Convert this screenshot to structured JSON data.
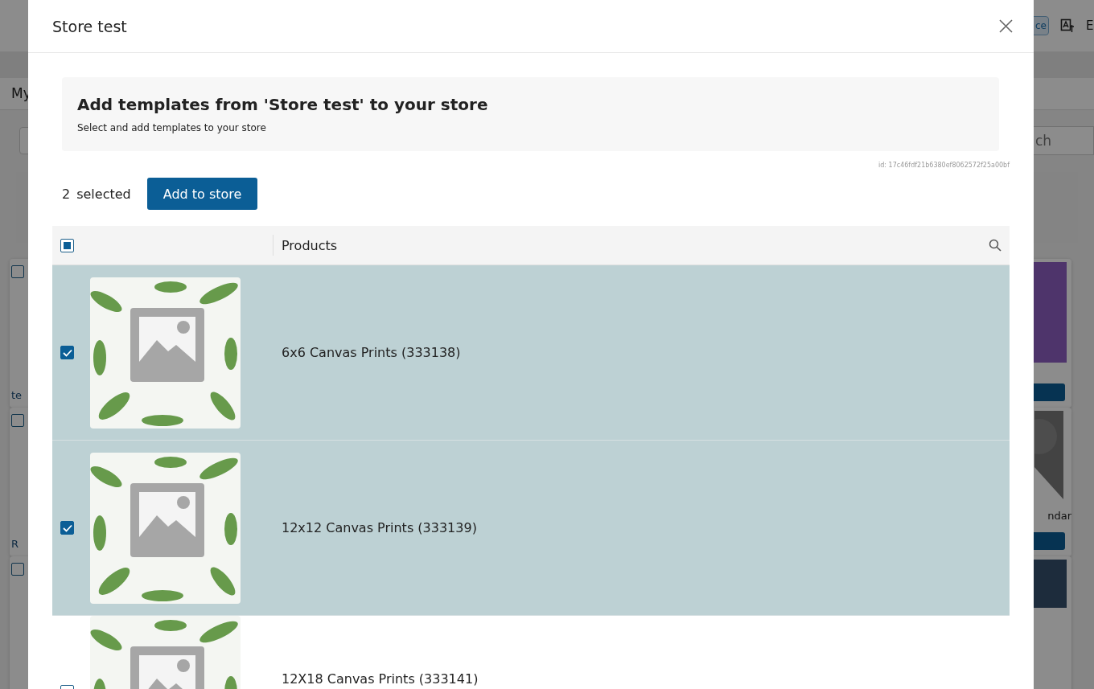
{
  "background": {
    "header_button": "ce",
    "header_link": "E",
    "tab": "My",
    "search": {
      "placeholder": "ch"
    },
    "card_rows": [
      {
        "left": {
          "label": "te",
          "checked": false
        },
        "right": {
          "kind": "purple"
        }
      },
      {
        "left": {
          "label": "R",
          "checked": false
        },
        "right": {
          "kind": "person",
          "label": "ndar"
        }
      },
      {
        "left": {
          "checked": false
        },
        "right": {
          "kind": "photo"
        }
      }
    ]
  },
  "modal": {
    "title": "Store test",
    "banner": {
      "heading": "Add templates from 'Store test' to your store",
      "text": "Select and add templates to your store"
    },
    "id_text": "id: 17c46fdf21b6380ef8062572f25a00bf",
    "selected_count": "2",
    "selected_label": "selected",
    "add_button": "Add to store",
    "table": {
      "select_all": {
        "indeterminate": true
      },
      "column": "Products",
      "rows": [
        {
          "name": "6x6 Canvas Prints (333138)",
          "checked": true
        },
        {
          "name": "12x12 Canvas Prints (333139)",
          "checked": true
        },
        {
          "name": "12X18 Canvas Prints (333141)",
          "checked": false
        }
      ]
    }
  }
}
